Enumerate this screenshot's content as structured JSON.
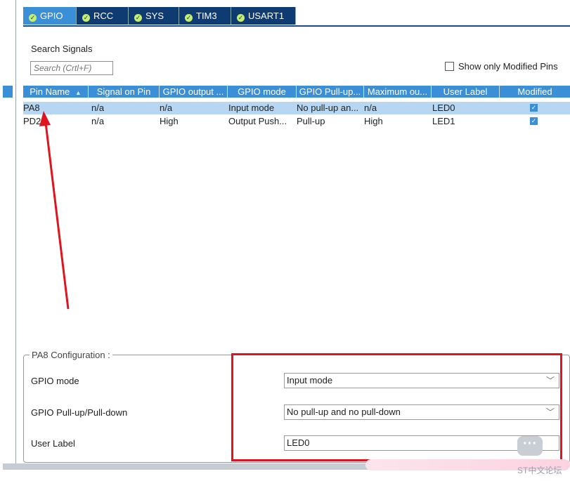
{
  "tabs": [
    {
      "label": "GPIO",
      "active": true
    },
    {
      "label": "RCC",
      "active": false
    },
    {
      "label": "SYS",
      "active": false
    },
    {
      "label": "TIM3",
      "active": false
    },
    {
      "label": "USART1",
      "active": false
    }
  ],
  "search": {
    "label": "Search Signals",
    "placeholder": "Search (Crtl+F)"
  },
  "show_modified": {
    "label": "Show only Modified Pins",
    "checked": false
  },
  "table": {
    "headers": [
      "Pin Name",
      "Signal on Pin",
      "GPIO output ...",
      "GPIO mode",
      "GPIO Pull-up...",
      "Maximum ou...",
      "User Label",
      "Modified"
    ],
    "sort_indicator": "▲",
    "rows": [
      {
        "pin": "PA8",
        "signal": "n/a",
        "output": "n/a",
        "mode": "Input mode",
        "pull": "No pull-up an...",
        "speed": "n/a",
        "label": "LED0",
        "modified": true,
        "selected": true
      },
      {
        "pin": "PD2",
        "signal": "n/a",
        "output": "High",
        "mode": "Output Push...",
        "pull": "Pull-up",
        "speed": "High",
        "label": "LED1",
        "modified": true,
        "selected": false
      }
    ]
  },
  "config": {
    "legend": "PA8 Configuration :",
    "fields": [
      {
        "label": "GPIO mode",
        "value": "Input mode"
      },
      {
        "label": "GPIO Pull-up/Pull-down",
        "value": "No pull-up and no pull-down"
      },
      {
        "label": "User Label",
        "value": "LED0"
      }
    ]
  },
  "watermark": "ST中文论坛",
  "colors": {
    "tab_bg": "#0f3b73",
    "tab_active": "#3a8fd6",
    "header_bg": "#3a8fd6",
    "selected_row": "#b7d6f1",
    "annotation_red": "#e0141e"
  }
}
